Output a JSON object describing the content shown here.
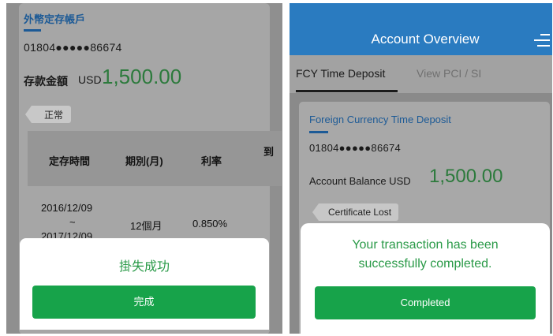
{
  "left": {
    "card_title": "外幣定存帳戶",
    "account_number": "01804●●●●●86674",
    "balance_label": "存款金額",
    "currency": "USD",
    "amount": "1,500.00",
    "status": "正常",
    "table": {
      "headers": [
        "定存時間",
        "期別(月)",
        "利率",
        "到"
      ],
      "row": {
        "start_date": "2016/12/09",
        "tilde": "~",
        "end_date": "2017/12/09",
        "term": "12個月",
        "rate": "0.850%"
      }
    },
    "overlay_message": "掛失成功",
    "button_label": "完成"
  },
  "right": {
    "header_title": "Account Overview",
    "menu_icon": "hamburger-menu-icon",
    "tabs": [
      {
        "label": "FCY Time Deposit",
        "active": true
      },
      {
        "label": "View PCI / SI",
        "active": false
      }
    ],
    "card_title": "Foreign Currency Time Deposit",
    "account_number": "01804●●●●●86674",
    "balance_label": "Account Balance USD",
    "amount": "1,500.00",
    "status": "Certificate Lost",
    "overlay_message_line1": "Your transaction has been",
    "overlay_message_line2": "successfully completed.",
    "button_label": "Completed"
  },
  "colors": {
    "header_blue": "#2a7bc0",
    "success_green": "#2a9a48",
    "button_green": "#17a34a",
    "amount_green": "#2c7a3c",
    "link_blue": "#1c5a96"
  }
}
